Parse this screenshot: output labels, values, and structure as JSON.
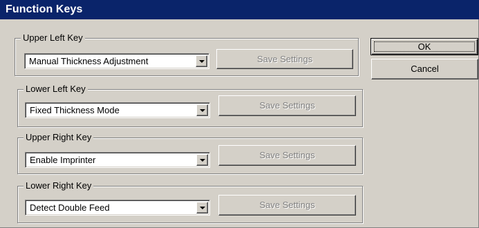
{
  "window": {
    "title": "Function Keys"
  },
  "groups": [
    {
      "label": "Upper Left Key",
      "selected": "Manual Thickness Adjustment",
      "save_label": "Save Settings"
    },
    {
      "label": "Lower Left Key",
      "selected": "Fixed Thickness Mode",
      "save_label": "Save Settings"
    },
    {
      "label": "Upper Right Key",
      "selected": "Enable Imprinter",
      "save_label": "Save Settings"
    },
    {
      "label": "Lower Right Key",
      "selected": "Detect Double Feed",
      "save_label": "Save Settings"
    }
  ],
  "buttons": {
    "ok": "OK",
    "cancel": "Cancel"
  },
  "icons": {
    "dropdown": "chevron-down-icon"
  }
}
